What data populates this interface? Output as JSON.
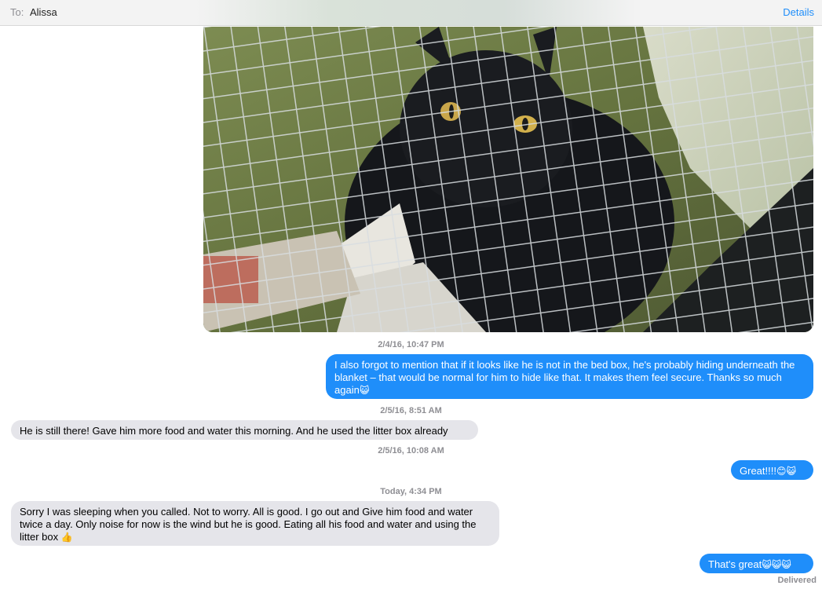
{
  "header": {
    "to_label": "To:",
    "recipient": "Alissa",
    "details_label": "Details"
  },
  "photo": {
    "subject": "black cat in wire cage trap"
  },
  "messages": [
    {
      "timestamp": "2/4/16, 10:47 PM"
    },
    {
      "direction": "outgoing",
      "text": "I also forgot to mention that if it looks like he is not in the bed box, he's probably hiding underneath the blanket – that would be normal for him to hide like that. It makes them feel secure. Thanks so much again",
      "emoji": "😺"
    },
    {
      "timestamp": "2/5/16, 8:51 AM"
    },
    {
      "direction": "incoming",
      "text": "He is still there! Gave him more food and water this morning. And he used the litter box already"
    },
    {
      "timestamp": "2/5/16, 10:08 AM"
    },
    {
      "direction": "outgoing",
      "text": "Great!!!!",
      "emoji": "😊😺"
    },
    {
      "timestamp": "Today, 4:34 PM"
    },
    {
      "direction": "incoming",
      "text": "Sorry I was sleeping when you called. Not to worry. All is good. I go out and Give him food and water twice a day. Only noise for now is the wind but he is good. Eating all his food and water and using the litter box",
      "emoji": "👍"
    },
    {
      "direction": "outgoing",
      "text": "That's great",
      "emoji": "😺😺😺"
    }
  ],
  "status": {
    "delivered": "Delivered"
  },
  "colors": {
    "outgoing_bubble": "#1f8efa",
    "incoming_bubble": "#e5e5ea",
    "timestamp": "#8e8e93",
    "link": "#1f8efa"
  }
}
